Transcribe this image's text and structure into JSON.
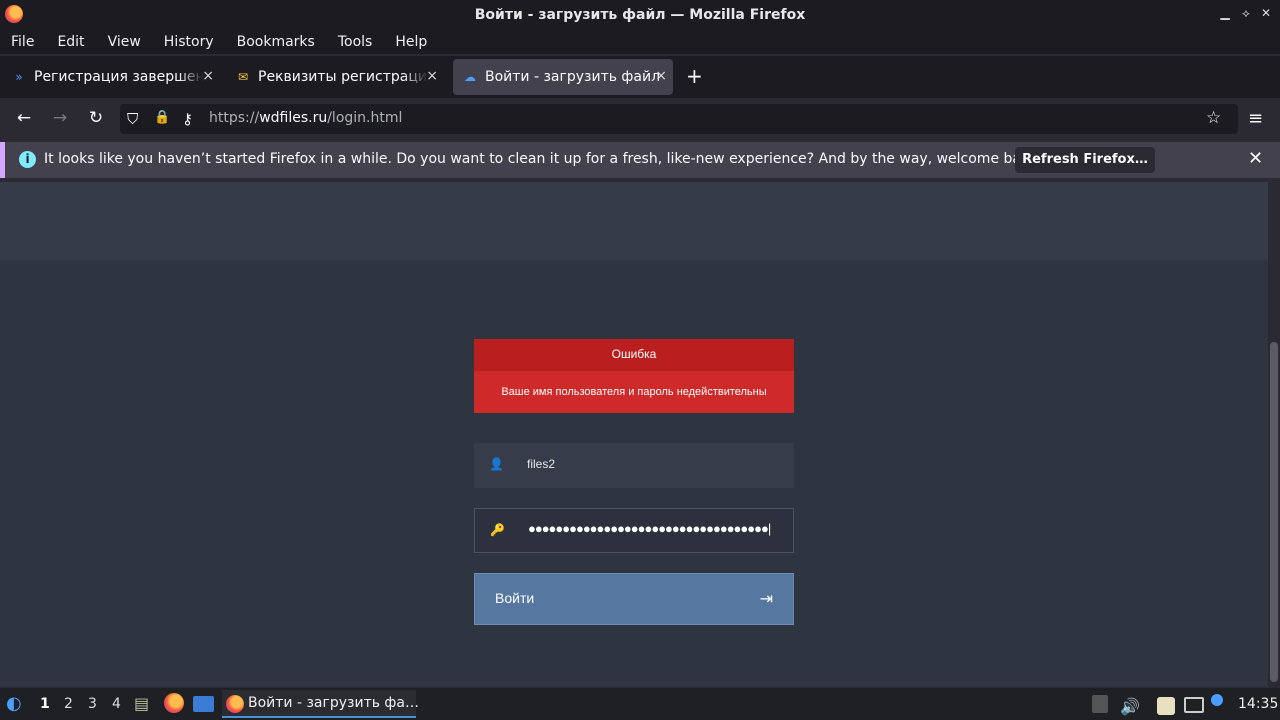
{
  "window": {
    "title": "Войти - загрузить файл — Mozilla Firefox",
    "minimize_icon": "▁",
    "restore_icon": "⟡",
    "close_icon": "✕"
  },
  "menu": [
    "File",
    "Edit",
    "View",
    "History",
    "Bookmarks",
    "Tools",
    "Help"
  ],
  "tabs": [
    {
      "label": "Регистрация завершена",
      "favicon": "»"
    },
    {
      "label": "Реквизиты регистрации",
      "favicon": "✉"
    },
    {
      "label": "Войти - загрузить файл",
      "favicon": "☁"
    }
  ],
  "tab_close": "×",
  "new_tab": "+",
  "nav": {
    "back": "←",
    "forward": "→",
    "reload": "↻",
    "menu": "≡"
  },
  "url": {
    "prefix": "https://",
    "domain": "wdfiles.ru",
    "path": "/login.html"
  },
  "url_icons": {
    "shield": "⛉",
    "lock": "🔒",
    "key": "⚷",
    "star": "☆"
  },
  "notification": {
    "info_icon": "i",
    "message": "It looks like you haven’t started Firefox in a while. Do you want to clean it up for a fresh, like-new experience? And by the way, welcome back!",
    "button": "Refresh Firefox…",
    "close_icon": "✕"
  },
  "error": {
    "title": "Ошибка",
    "message": "Ваше имя пользователя и пароль недействительны"
  },
  "form": {
    "username_icon": "👤",
    "username_value": "files2",
    "password_icon": "🔑",
    "password_value": "●●●●●●●●●●●●●●●●●●●●●●●●●●●●●●●●●●●|",
    "login_label": "Войти",
    "login_icon": "⇥"
  },
  "taskbar": {
    "workspaces": [
      "1",
      "2",
      "3",
      "4"
    ],
    "task_label": "Войти - загрузить фа…",
    "clock": "14:35"
  }
}
